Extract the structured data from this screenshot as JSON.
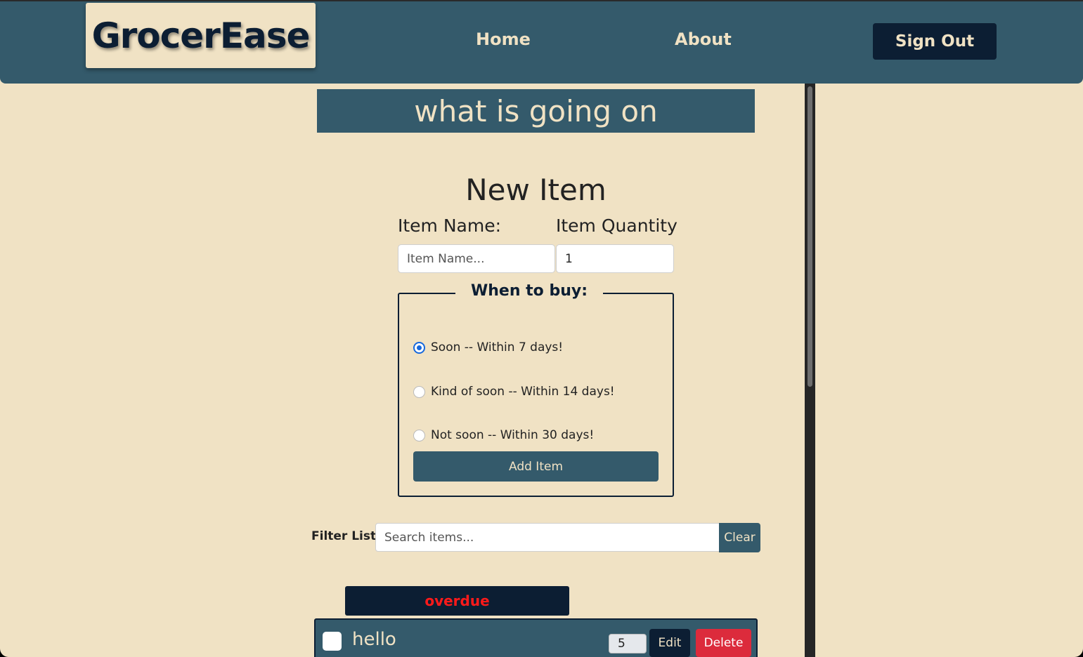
{
  "header": {
    "logo": "GrocerEase",
    "nav": {
      "home": "Home",
      "about": "About"
    },
    "sign_out": "Sign Out"
  },
  "banner": "what is going on",
  "new_item": {
    "title": "New Item",
    "name_label": "Item Name:",
    "name_placeholder": "Item Name...",
    "quantity_label": "Item Quantity",
    "quantity_value": "1",
    "when_to_buy": {
      "legend": "When to buy:",
      "options": [
        {
          "label": "Soon -- Within 7 days!",
          "checked": true
        },
        {
          "label": "Kind of soon -- Within 14 days!",
          "checked": false
        },
        {
          "label": "Not soon -- Within 30 days!",
          "checked": false
        }
      ]
    },
    "add_button": "Add Item"
  },
  "filter": {
    "label": "Filter List:",
    "placeholder": "Search items...",
    "clear_button": "Clear"
  },
  "list": {
    "group_label": "overdue",
    "items": [
      {
        "name": "hello",
        "quantity": "5",
        "edit": "Edit",
        "delete": "Delete"
      }
    ]
  },
  "colors": {
    "background": "#f0e2c4",
    "primary": "#345a6b",
    "dark": "#0c1e33",
    "danger": "#dc2b3c",
    "overdue_text": "#ff1a1a"
  }
}
